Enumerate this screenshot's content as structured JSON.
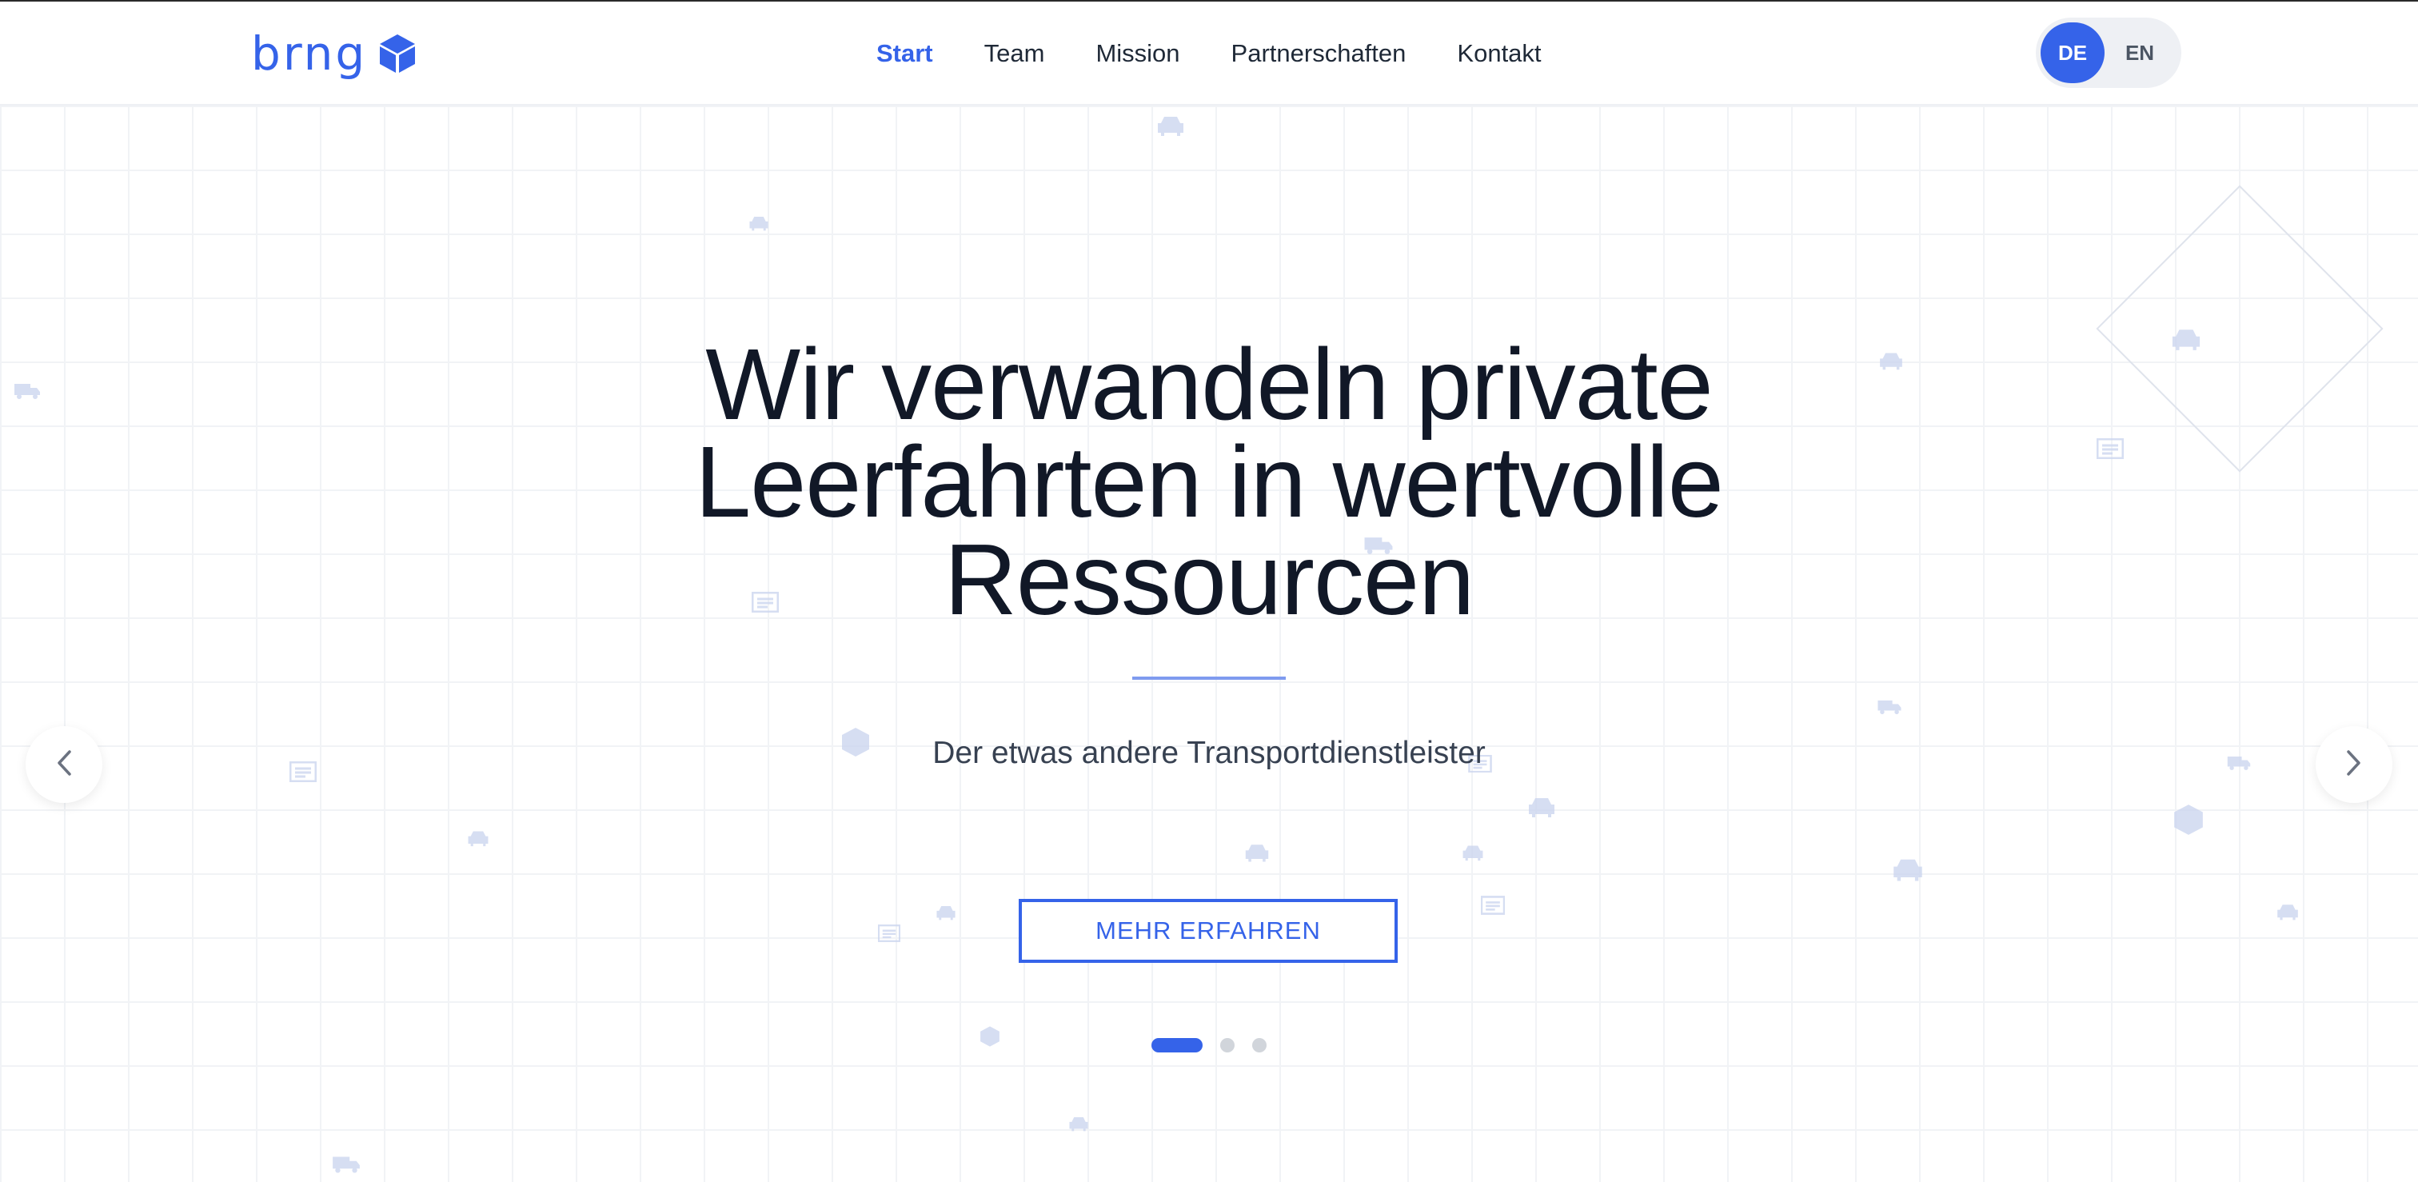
{
  "brand": {
    "name": "brng",
    "logo_icon": "cube-icon",
    "accent_color": "#3563e9"
  },
  "nav": {
    "items": [
      {
        "label": "Start",
        "active": true
      },
      {
        "label": "Team",
        "active": false
      },
      {
        "label": "Mission",
        "active": false
      },
      {
        "label": "Partnerschaften",
        "active": false
      },
      {
        "label": "Kontakt",
        "active": false
      }
    ]
  },
  "language": {
    "options": [
      "DE",
      "EN"
    ],
    "selected": "DE"
  },
  "hero": {
    "headline_lines": [
      "Wir verwandeln private",
      "Leerfahrten in wertvolle",
      "Ressourcen"
    ],
    "subtitle": "Der etwas andere Transportdienstleister",
    "cta_label": "MEHR ERFAHREN",
    "slides_total": 3,
    "active_slide": 1
  },
  "carousel": {
    "prev_icon": "chevron-left-icon",
    "next_icon": "chevron-right-icon"
  },
  "background": {
    "icons": [
      "car-icon",
      "truck-icon",
      "document-icon",
      "box-icon"
    ]
  }
}
